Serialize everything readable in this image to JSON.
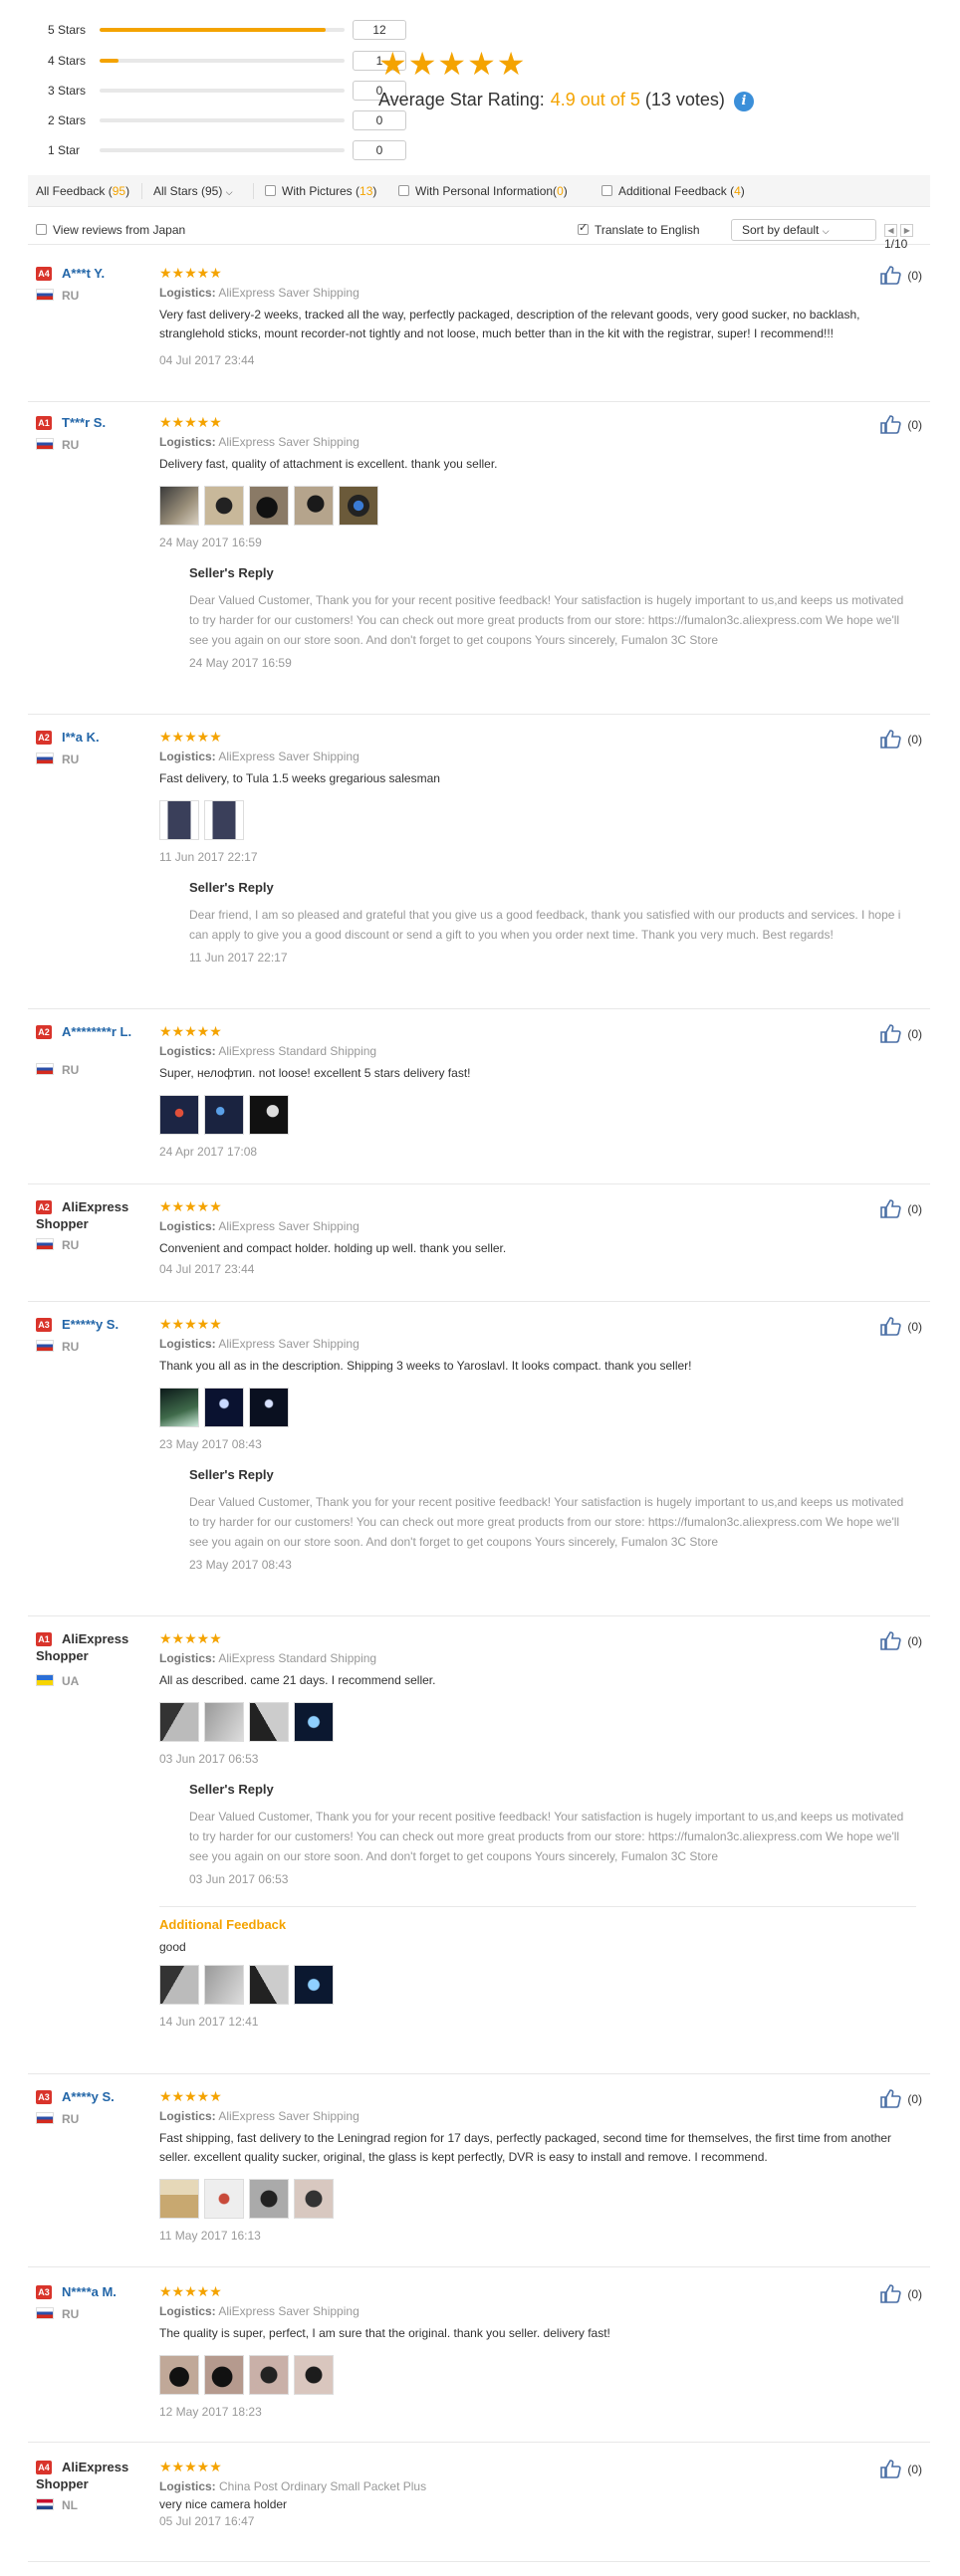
{
  "rating_summary": {
    "rows": [
      {
        "label": "5 Stars",
        "count": "12",
        "fraction": 0.923
      },
      {
        "label": "4 Stars",
        "count": "1",
        "fraction": 0.077
      },
      {
        "label": "3 Stars",
        "count": "0",
        "fraction": 0
      },
      {
        "label": "2 Stars",
        "count": "0",
        "fraction": 0
      },
      {
        "label": "1 Star",
        "count": "0",
        "fraction": 0
      }
    ],
    "big_stars": "★★★★★",
    "avg_label": "Average Star Rating:",
    "avg_score": "4.9 out of 5",
    "votes": "(13 votes)",
    "info_glyph": "i"
  },
  "filters": {
    "all_feedback_label": "All Feedback (",
    "all_feedback_count": "95",
    "all_feedback_close": ")",
    "all_stars": "All Stars (95)",
    "with_pictures_label": "With Pictures (",
    "with_pictures_count": "13",
    "with_pictures_close": ")",
    "with_personal_label": "With Personal Information(",
    "with_personal_count": "0",
    "with_personal_close": ")",
    "additional_label": "Additional Feedback (",
    "additional_count": "4",
    "additional_close": ")",
    "view_japan": "View reviews from Japan",
    "translate": "Translate to English",
    "sort": "Sort by default",
    "page": "1/10"
  },
  "labels": {
    "logistics": "Logistics:",
    "sellers_reply": "Seller's Reply",
    "additional_feedback": "Additional Feedback",
    "stars": "★★★★★"
  },
  "reviews": [
    {
      "level": "A4",
      "name": "A***t Y.",
      "country": "RU",
      "flag": "ru",
      "logistics": "AliExpress Saver Shipping",
      "text": "Very fast delivery-2 weeks, tracked all the way, perfectly packaged, description of the relevant goods, very good sucker, no backlash, stranglehold sticks, mount recorder-not tightly and not loose, much better than in the kit with the registrar, super! I recommend!!!",
      "date": "04 Jul 2017 23:44",
      "likes": "(0)"
    },
    {
      "level": "A1",
      "name": "T***r S.",
      "country": "RU",
      "flag": "ru",
      "logistics": "AliExpress Saver Shipping",
      "text": "Delivery fast, quality of attachment is excellent. thank you seller.",
      "date": "24 May 2017 16:59",
      "likes": "(0)",
      "reply": "Dear Valued Customer, Thank you for your recent positive feedback! Your satisfaction is hugely important to us,and keeps us motivated to try harder for our customers! You can check out more great products from our store: https://fumalon3c.aliexpress.com We hope we'll see you again on our store soon. And don't forget to get coupons Yours sincerely, Fumalon 3C Store",
      "reply_date": "24 May 2017 16:59"
    },
    {
      "level": "A2",
      "name": "I**a K.",
      "country": "RU",
      "flag": "ru",
      "logistics": "AliExpress Saver Shipping",
      "text": "Fast delivery, to Tula 1.5 weeks gregarious salesman",
      "date": "11 Jun 2017 22:17",
      "likes": "(0)",
      "reply": "Dear friend, I am so pleased and grateful that you give us a good feedback, thank you satisfied with our products and services. I hope i can apply to give you a good discount or send a gift to you when you order next time. Thank you very much. Best regards!",
      "reply_date": "11 Jun 2017 22:17"
    },
    {
      "level": "A2",
      "name": "A********r L.",
      "country": "RU",
      "flag": "ru",
      "logistics": "AliExpress Standard Shipping",
      "text": "Super, нелофтип. not loose! excellent 5 stars delivery fast!",
      "date": "24 Apr 2017 17:08",
      "likes": "(0)"
    },
    {
      "level": "A2",
      "name": "AliExpress Shopper",
      "country": "RU",
      "flag": "ru",
      "logistics": "AliExpress Saver Shipping",
      "text": "Convenient and compact holder. holding up well. thank you seller.",
      "date": "04 Jul 2017 23:44",
      "likes": "(0)"
    },
    {
      "level": "A3",
      "name": "E*****y S.",
      "country": "RU",
      "flag": "ru",
      "logistics": "AliExpress Saver Shipping",
      "text": "Thank you all as in the description. Shipping 3 weeks to Yaroslavl. It looks compact. thank you seller!",
      "date": "23 May 2017 08:43",
      "likes": "(0)",
      "reply": "Dear Valued Customer, Thank you for your recent positive feedback! Your satisfaction is hugely important to us,and keeps us motivated to try harder for our customers! You can check out more great products from our store: https://fumalon3c.aliexpress.com We hope we'll see you again on our store soon. And don't forget to get coupons Yours sincerely, Fumalon 3C Store",
      "reply_date": "23 May 2017 08:43"
    },
    {
      "level": "A1",
      "name": "AliExpress Shopper",
      "country": "UA",
      "flag": "ua",
      "logistics": "AliExpress Standard Shipping",
      "text": "All as described. came 21 days. I recommend seller.",
      "date": "03 Jun 2017 06:53",
      "likes": "(0)",
      "reply": "Dear Valued Customer, Thank you for your recent positive feedback! Your satisfaction is hugely important to us,and keeps us motivated to try harder for our customers! You can check out more great products from our store: https://fumalon3c.aliexpress.com We hope we'll see you again on our store soon. And don't forget to get coupons Yours sincerely, Fumalon 3C Store",
      "reply_date": "03 Jun 2017 06:53",
      "additional_text": "good",
      "additional_date": "14 Jun 2017 12:41"
    },
    {
      "level": "A3",
      "name": "A****y S.",
      "country": "RU",
      "flag": "ru",
      "logistics": "AliExpress Saver Shipping",
      "text": "Fast shipping, fast delivery to the Leningrad region for 17 days, perfectly packaged, second time for themselves, the first time from another seller. excellent quality sucker, original, the glass is kept perfectly, DVR is easy to install and remove. I recommend.",
      "date": "11 May 2017 16:13",
      "likes": "(0)"
    },
    {
      "level": "A3",
      "name": "N****a M.",
      "country": "RU",
      "flag": "ru",
      "logistics": "AliExpress Saver Shipping",
      "text": "The quality is super, perfect, I am sure that the original. thank you seller. delivery fast!",
      "date": "12 May 2017 18:23",
      "likes": "(0)"
    },
    {
      "level": "A4",
      "name": "AliExpress Shopper",
      "country": "NL",
      "flag": "nl",
      "logistics": "China Post Ordinary Small Packet Plus",
      "text": "very nice camera holder",
      "date": "05 Jul 2017 16:47",
      "likes": "(0)"
    }
  ]
}
